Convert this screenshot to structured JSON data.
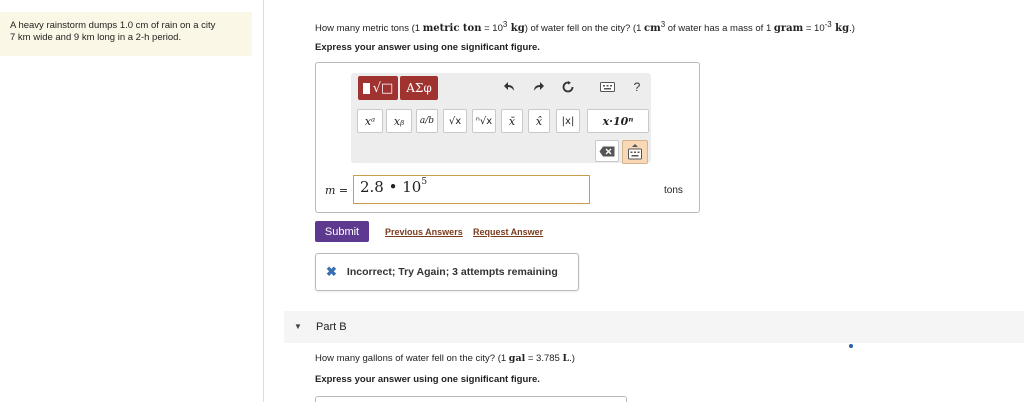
{
  "problem": {
    "line1": "A heavy rainstorm dumps 1.0 cm of rain on a city",
    "line2": "7 km wide and 9 km long in a 2-h period."
  },
  "part_a": {
    "question_pre": "How many metric tons (1 ",
    "question_unit1": "metric ton",
    "question_mid1": " = 10",
    "question_exp1": "3",
    "question_unit2": " kg",
    "question_mid2": ") of water fell on the city? (1 ",
    "question_unit3": "cm",
    "question_exp2": "3",
    "question_mid3": " of water has a mass of 1 ",
    "question_unit4": "gram",
    "question_mid4": " = 10",
    "question_exp3": "-3",
    "question_unit5": " kg",
    "question_end": ".)",
    "instruction": "Express your answer using one significant figure.",
    "toolbar": {
      "templates_icon": "templates-icon",
      "greek_label": "ΑΣφ",
      "undo_icon": "undo-icon",
      "redo_icon": "redo-icon",
      "reset_icon": "reset-icon",
      "keyboard_icon": "keyboard-icon",
      "help_label": "?"
    },
    "math_buttons": [
      "xᵃ",
      "xᵦ",
      "a/b",
      "√x",
      "ⁿ√x",
      "x̄",
      "x̂",
      "|x|",
      "x·10ⁿ"
    ],
    "variable_label": "m =",
    "answer_mantissa": "2.8 • 10",
    "answer_exponent": "5",
    "units": "tons",
    "submit_label": "Submit",
    "previous_answers_label": "Previous Answers",
    "request_answer_label": "Request Answer",
    "feedback_icon": "x-icon",
    "feedback_text": "Incorrect; Try Again; 3 attempts remaining"
  },
  "part_b": {
    "label": "Part B",
    "question_pre": "How many gallons of water fell on the city? (1 ",
    "question_unit1": "gal",
    "question_mid": " = 3.785 ",
    "question_unit2": "L",
    "question_end": ".)",
    "instruction": "Express your answer using one significant figure."
  },
  "colors": {
    "accent_red": "#a0322f",
    "submit_purple": "#5d3a8f",
    "link_brown": "#7a3b1e",
    "feedback_blue": "#3a6fb3",
    "problem_bg": "#fbf7e6"
  }
}
